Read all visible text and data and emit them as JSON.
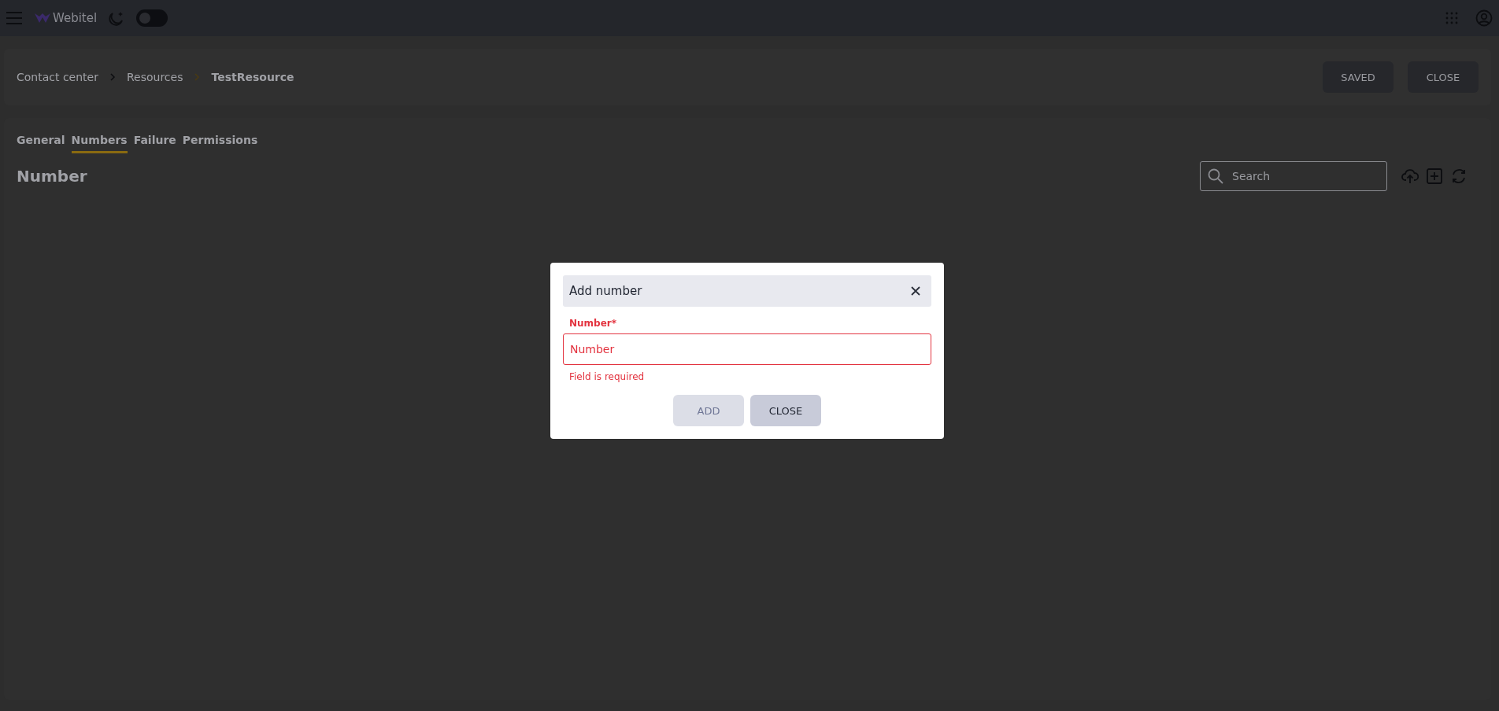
{
  "topbar": {
    "brand": "Webitel",
    "dark_mode": {
      "on": false
    }
  },
  "breadcrumb": [
    {
      "label": "Contact center",
      "current": false
    },
    {
      "label": "Resources",
      "current": false
    },
    {
      "label": "TestResource",
      "current": true
    }
  ],
  "header_buttons": [
    "SAVED",
    "CLOSE"
  ],
  "tabs": [
    {
      "label": "General",
      "selected": false
    },
    {
      "label": "Numbers",
      "selected": true
    },
    {
      "label": "Failure",
      "selected": false
    },
    {
      "label": "Permissions",
      "selected": false
    }
  ],
  "section": {
    "title": "Number",
    "search": {
      "placeholder": "Search"
    }
  },
  "dialog": {
    "title": "Add number",
    "field": {
      "label": "Number*",
      "placeholder": "Number",
      "error": "Field is required",
      "invalid": true
    },
    "buttons": [
      {
        "label": "ADD",
        "disabled": true
      },
      {
        "label": "CLOSE",
        "disabled": false
      }
    ]
  }
}
